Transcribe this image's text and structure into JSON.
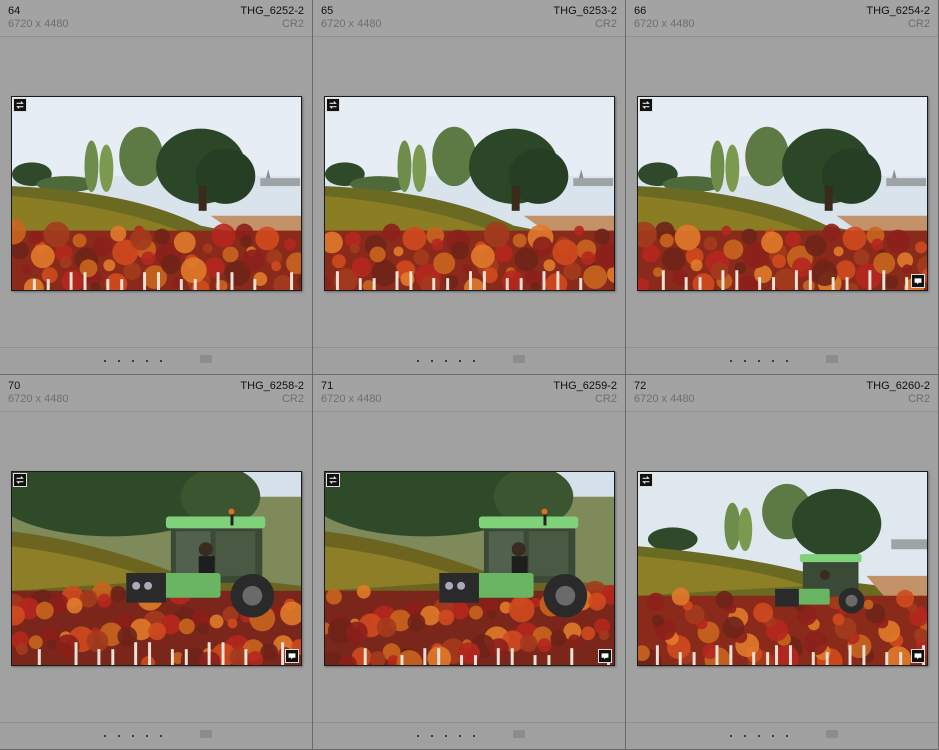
{
  "cells": [
    {
      "index": "64",
      "filename": "THG_6252-2",
      "dimensions": "6720 x 4480",
      "extension": "CR2",
      "scene": "landscape",
      "comment_badge": false
    },
    {
      "index": "65",
      "filename": "THG_6253-2",
      "dimensions": "6720 x 4480",
      "extension": "CR2",
      "scene": "landscape",
      "comment_badge": false
    },
    {
      "index": "66",
      "filename": "THG_6254-2",
      "dimensions": "6720 x 4480",
      "extension": "CR2",
      "scene": "landscape",
      "comment_badge": true
    },
    {
      "index": "70",
      "filename": "THG_6258-2",
      "dimensions": "6720 x 4480",
      "extension": "CR2",
      "scene": "tractor-close",
      "comment_badge": true
    },
    {
      "index": "71",
      "filename": "THG_6259-2",
      "dimensions": "6720 x 4480",
      "extension": "CR2",
      "scene": "tractor-close",
      "comment_badge": true
    },
    {
      "index": "72",
      "filename": "THG_6260-2",
      "dimensions": "6720 x 4480",
      "extension": "CR2",
      "scene": "tractor-far",
      "comment_badge": true
    }
  ],
  "icons": {
    "sync": "sync-arrows-icon",
    "comment": "comment-icon"
  },
  "colors": {
    "cell_bg": "#a1a1a1",
    "grid_line": "#6a6a6a",
    "tractor_green": "#5fae5a"
  }
}
